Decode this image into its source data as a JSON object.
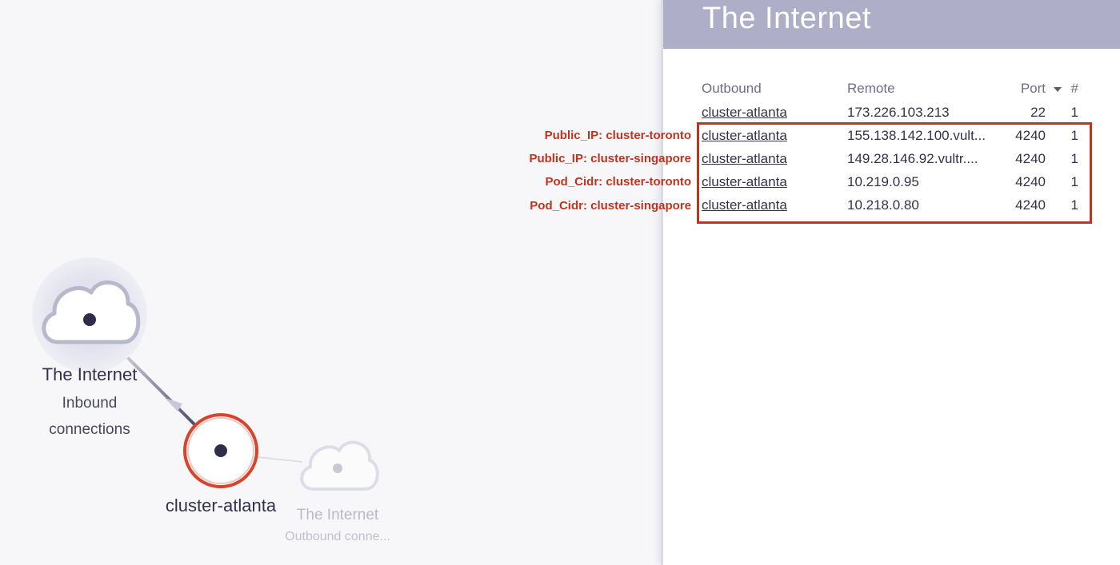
{
  "graph": {
    "nodes": [
      {
        "id": "internet-inbound",
        "title": "The Internet",
        "subtitle_lines": [
          "Inbound",
          "connections"
        ]
      },
      {
        "id": "cluster-atlanta",
        "title": "cluster-atlanta"
      },
      {
        "id": "internet-outbound",
        "title": "The Internet",
        "subtitle": "Outbound conne..."
      }
    ],
    "colors": {
      "selected_ring": "#d8432a",
      "node_dot": "#2e2e4a",
      "cloud_stroke": "#b8b8cc"
    }
  },
  "panel": {
    "title": "The Internet",
    "table": {
      "headers": {
        "outbound": "Outbound",
        "remote": "Remote",
        "port": "Port",
        "count": "#"
      },
      "rows": [
        {
          "outbound": "cluster-atlanta",
          "remote": "173.226.103.213",
          "port": "22",
          "count": "1"
        },
        {
          "outbound": "cluster-atlanta",
          "remote": "155.138.142.100.vult...",
          "port": "4240",
          "count": "1"
        },
        {
          "outbound": "cluster-atlanta",
          "remote": "149.28.146.92.vultr....",
          "port": "4240",
          "count": "1"
        },
        {
          "outbound": "cluster-atlanta",
          "remote": "10.219.0.95",
          "port": "4240",
          "count": "1"
        },
        {
          "outbound": "cluster-atlanta",
          "remote": "10.218.0.80",
          "port": "4240",
          "count": "1"
        }
      ]
    }
  },
  "annotations": {
    "labels": [
      "Public_IP: cluster-toronto",
      "Public_IP: cluster-singapore",
      "Pod_Cidr: cluster-toronto",
      "Pod_Cidr: cluster-singapore"
    ],
    "color": "#c0341d"
  }
}
